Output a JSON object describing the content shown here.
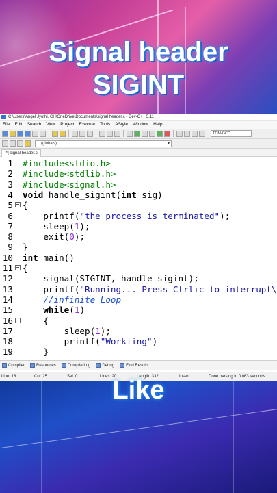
{
  "overlay": {
    "title_line1": "Signal header",
    "title_line2": "SIGINT",
    "bottom_text": "Like"
  },
  "window": {
    "title": "C:\\Users\\Angel Jyothi. CH\\OneDrive\\Documents\\signal header.c - Dev-C++ 5.11",
    "menu": [
      "File",
      "Edit",
      "Search",
      "View",
      "Project",
      "Execute",
      "Tools",
      "AStyle",
      "Window",
      "Help"
    ],
    "compiler_combo": "TDM-GCC",
    "scope_combo": "(globals)",
    "file_tab": "[*] signal header.c"
  },
  "editor": {
    "lines": [
      {
        "n": "1",
        "text": "#include<stdio.h>"
      },
      {
        "n": "2",
        "text": "#include<stdlib.h>"
      },
      {
        "n": "3",
        "text": "#include<signal.h>"
      },
      {
        "n": "4",
        "text": "void handle_sigint(int sig)"
      },
      {
        "n": "5",
        "text": "{"
      },
      {
        "n": "6",
        "text": "    printf(\"the process is terminated\");"
      },
      {
        "n": "7",
        "text": "    sleep(1);"
      },
      {
        "n": "8",
        "text": "    exit(0);"
      },
      {
        "n": "9",
        "text": "}"
      },
      {
        "n": "10",
        "text": "int main()"
      },
      {
        "n": "11",
        "text": "{"
      },
      {
        "n": "12",
        "text": "    signal(SIGINT, handle_sigint);"
      },
      {
        "n": "13",
        "text": "    printf(\"Running... Press Ctrl+c to interrupt\\n\");"
      },
      {
        "n": "14",
        "text": "    //infinite Loop"
      },
      {
        "n": "15",
        "text": "    while(1)"
      },
      {
        "n": "16",
        "text": "    {"
      },
      {
        "n": "17",
        "text": "        sleep(1);"
      },
      {
        "n": "18",
        "text": "        printf(\"Workiing\")"
      },
      {
        "n": "19",
        "text": "    }"
      }
    ]
  },
  "bottom_tabs": [
    "Compiler",
    "Resources",
    "Compile Log",
    "Debug",
    "Find Results"
  ],
  "status": {
    "line": "Line:  18",
    "col": "Col:  25",
    "sel": "Sel:  0",
    "lines": "Lines:  20",
    "length": "Length:  332",
    "mode": "Insert",
    "message": "Done parsing in 0.063 seconds"
  }
}
